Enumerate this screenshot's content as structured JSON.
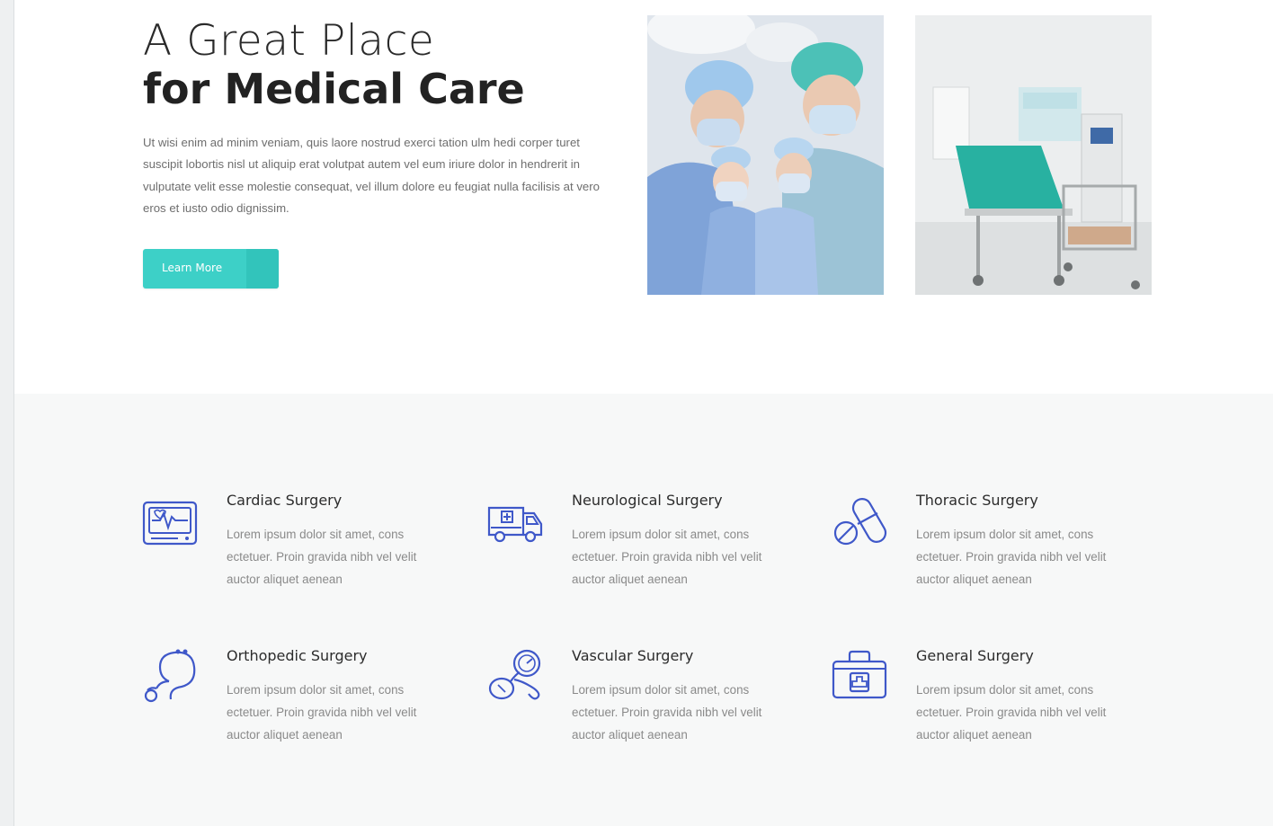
{
  "hero": {
    "title_line1": "A Great Place",
    "title_line2": "for Medical Care",
    "paragraph": "Ut wisi enim ad minim veniam, quis laore nostrud exerci tation ulm hedi corper turet suscipit lobortis nisl ut aliquip erat volutpat autem vel eum iriure dolor in hendrerit in vulputate velit esse molestie consequat, vel illum dolore eu feugiat nulla facilisis at vero eros et iusto odio dignissim.",
    "button_label": "Learn More"
  },
  "colors": {
    "accent": "#3dd0c7",
    "icon_blue": "#3f58c9",
    "section_bg": "#f7f8f8"
  },
  "services": [
    {
      "title": "Cardiac Surgery",
      "text": "Lorem ipsum dolor sit amet, cons ectetuer. Proin gravida nibh vel velit auctor aliquet aenean",
      "icon": "heart-monitor-icon"
    },
    {
      "title": "Neurological Surgery",
      "text": "Lorem ipsum dolor sit amet, cons ectetuer. Proin gravida nibh vel velit auctor aliquet aenean",
      "icon": "ambulance-icon"
    },
    {
      "title": "Thoracic Surgery",
      "text": "Lorem ipsum dolor sit amet, cons ectetuer. Proin gravida nibh vel velit auctor aliquet aenean",
      "icon": "pills-icon"
    },
    {
      "title": "Orthopedic Surgery",
      "text": "Lorem ipsum dolor sit amet, cons ectetuer. Proin gravida nibh vel velit auctor aliquet aenean",
      "icon": "stethoscope-icon"
    },
    {
      "title": "Vascular Surgery",
      "text": "Lorem ipsum dolor sit amet, cons ectetuer. Proin gravida nibh vel velit auctor aliquet aenean",
      "icon": "blood-pressure-gauge-icon"
    },
    {
      "title": "General Surgery",
      "text": "Lorem ipsum dolor sit amet, cons ectetuer. Proin gravida nibh vel velit auctor aliquet aenean",
      "icon": "first-aid-kit-icon"
    }
  ]
}
